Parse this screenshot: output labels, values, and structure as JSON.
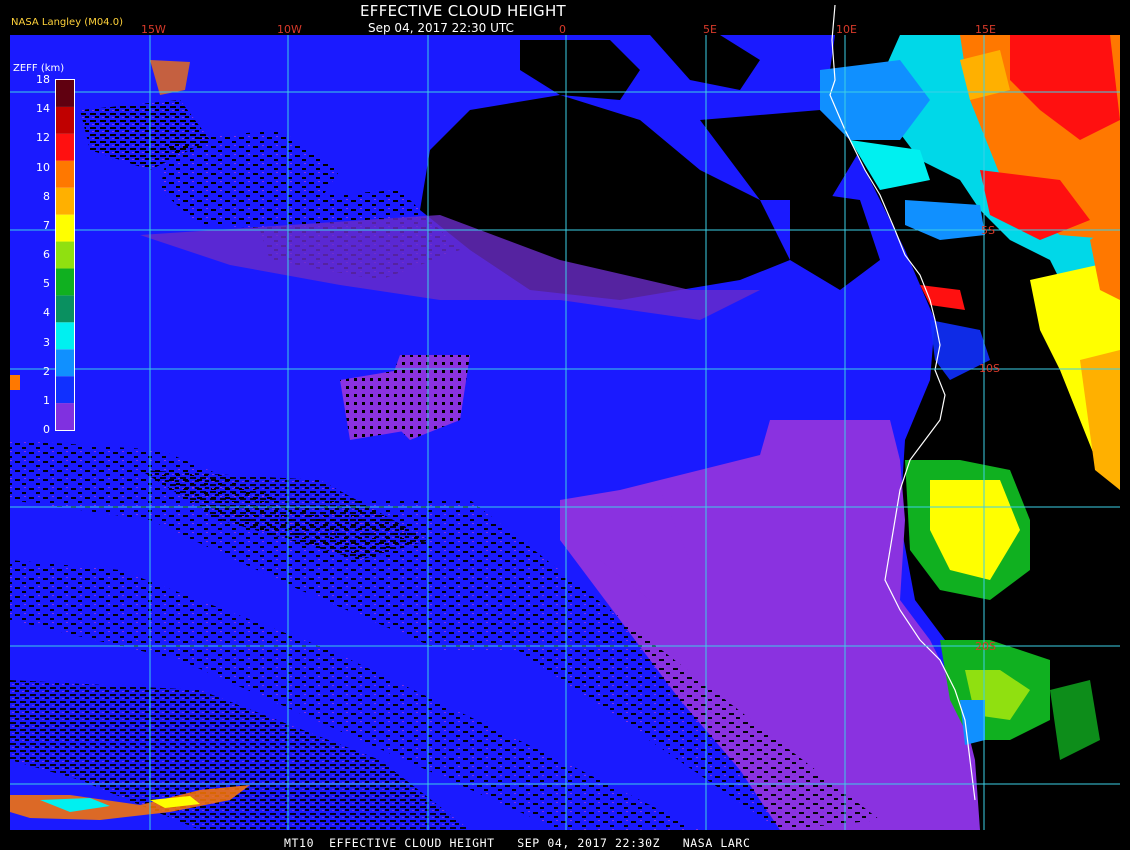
{
  "header": {
    "title": "EFFECTIVE CLOUD HEIGHT",
    "subtitle": "Sep 04, 2017 22:30 UTC",
    "source": "NASA Langley (M04.0)"
  },
  "footer": {
    "caption": "MT10  EFFECTIVE CLOUD HEIGHT   SEP 04, 2017 22:30Z   NASA LARC"
  },
  "legend": {
    "unit_label": "ZEFF (km)",
    "tick_labels": [
      "0",
      "1",
      "2",
      "3",
      "4",
      "5",
      "6",
      "7",
      "8",
      "10",
      "12",
      "14",
      "18"
    ],
    "colors": [
      "#8030e0",
      "#1030ff",
      "#1090ff",
      "#00f0f0",
      "#0a9060",
      "#10b020",
      "#90e010",
      "#ffff00",
      "#ffb000",
      "#ff7800",
      "#ff1010",
      "#c00000",
      "#600010"
    ]
  },
  "graticule": {
    "longitude_labels": [
      "15W",
      "10W",
      "0",
      "5E",
      "10E",
      "15E"
    ],
    "latitude_labels": [
      "5S",
      "10S",
      "20S"
    ],
    "line_color": "#3ccfe6"
  },
  "palette": {
    "ocean_low": "#1a1aff",
    "low_cloud": "#8a32e0",
    "clear": "#000000",
    "coastline": "#ffffff"
  }
}
